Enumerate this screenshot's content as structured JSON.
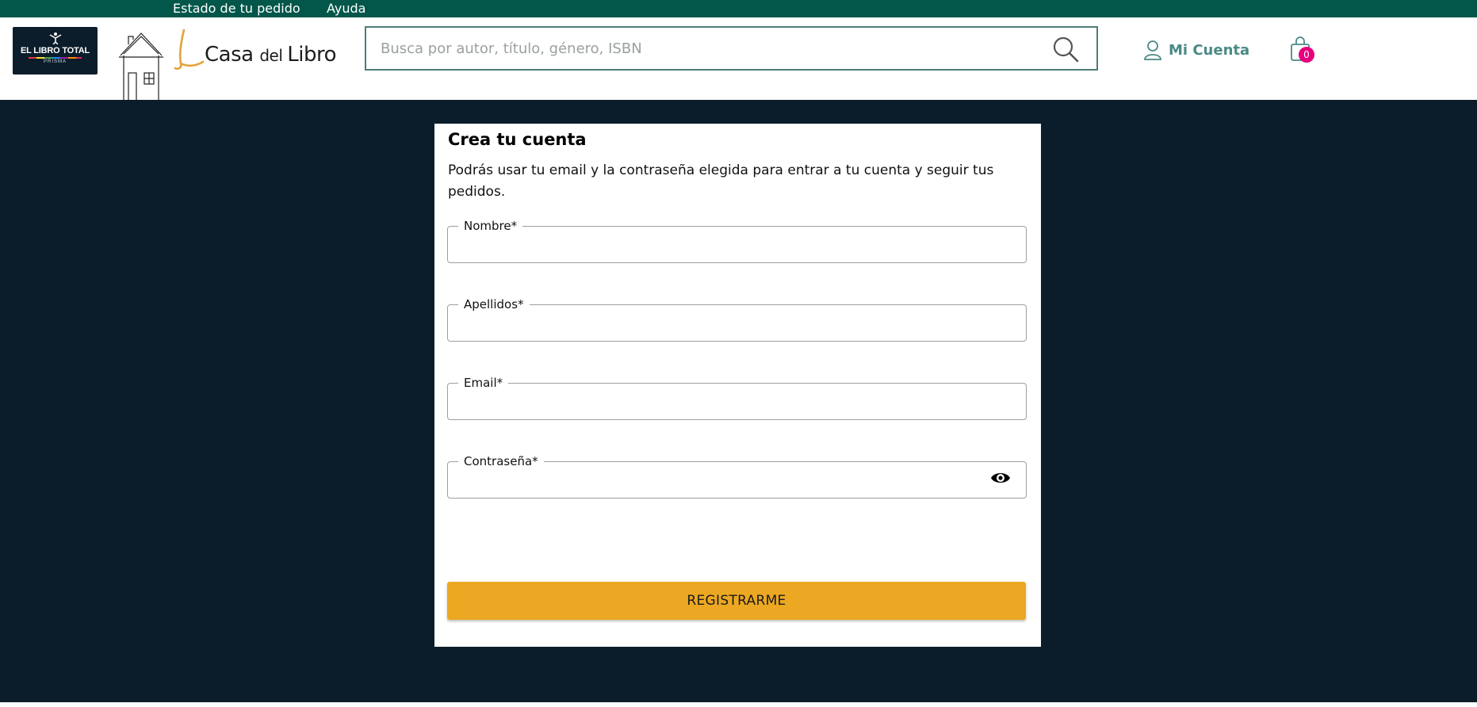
{
  "topbar": {
    "links": [
      "Estado de tu pedido",
      "Ayuda"
    ]
  },
  "header": {
    "logo_elt": {
      "main": "EL LIBRO TOTAL",
      "sub": "PRISMA"
    },
    "logo_cdl": {
      "word1": "Casa ",
      "word2": "del ",
      "word3": "Libro"
    },
    "search_placeholder": "Busca por autor, título, género, ISBN",
    "account_label": "Mi Cuenta",
    "cart_count": "0",
    "colors": {
      "brand_green": "#02574a",
      "accent_teal": "#4a8a85",
      "badge": "#e6007e"
    }
  },
  "form": {
    "title": "Crea tu cuenta",
    "description": "Podrás usar tu email y la contraseña elegida para entrar a tu cuenta y seguir tus pedidos.",
    "fields": [
      {
        "label": "Nombre*",
        "value": ""
      },
      {
        "label": "Apellidos*",
        "value": ""
      },
      {
        "label": "Email*",
        "value": ""
      },
      {
        "label": "Contraseña*",
        "value": ""
      }
    ],
    "submit_label": "REGISTRARME",
    "colors": {
      "button": "#eca822",
      "backdrop": "#0b1d2a"
    }
  }
}
